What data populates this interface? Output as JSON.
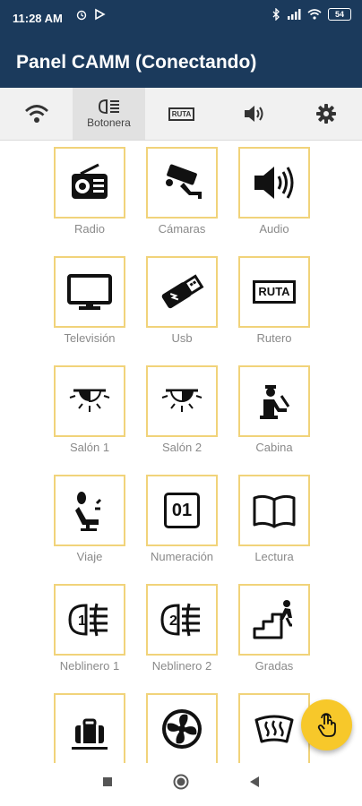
{
  "status": {
    "time": "11:28 AM",
    "battery": "54"
  },
  "app": {
    "title": "Panel CAMM (Conectando)"
  },
  "tabs": [
    {
      "icon": "wifi-icon",
      "label": ""
    },
    {
      "icon": "headlight-icon",
      "label": "Botonera"
    },
    {
      "icon": "ruta-icon",
      "label": "",
      "badge": "RUTA"
    },
    {
      "icon": "speaker-icon",
      "label": ""
    },
    {
      "icon": "gear-icon",
      "label": ""
    }
  ],
  "items": [
    {
      "label": "Radio",
      "icon": "radio-icon"
    },
    {
      "label": "Cámaras",
      "icon": "camera-icon"
    },
    {
      "label": "Audio",
      "icon": "speaker-icon"
    },
    {
      "label": "Televisión",
      "icon": "tv-icon"
    },
    {
      "label": "Usb",
      "icon": "usb-icon"
    },
    {
      "label": "Rutero",
      "icon": "ruta-icon",
      "badge": "RUTA"
    },
    {
      "label": "Salón 1",
      "icon": "ceiling-lamp-icon"
    },
    {
      "label": "Salón 2",
      "icon": "ceiling-lamp-icon"
    },
    {
      "label": "Cabina",
      "icon": "driver-icon"
    },
    {
      "label": "Viaje",
      "icon": "seat-icon"
    },
    {
      "label": "Numeración",
      "icon": "number-icon",
      "badge": "01"
    },
    {
      "label": "Lectura",
      "icon": "book-icon"
    },
    {
      "label": "Neblinero 1",
      "icon": "fog-light-icon",
      "badge": "1"
    },
    {
      "label": "Neblinero 2",
      "icon": "fog-light-icon",
      "badge": "2"
    },
    {
      "label": "Gradas",
      "icon": "stairs-icon"
    },
    {
      "label": "",
      "icon": "luggage-icon"
    },
    {
      "label": "",
      "icon": "fan-icon"
    },
    {
      "label": "",
      "icon": "defrost-icon"
    }
  ],
  "fab": {
    "icon": "touch-icon"
  },
  "colors": {
    "appbar": "#1b3a5c",
    "accent": "#f7c82a",
    "border": "#f1d37a"
  }
}
